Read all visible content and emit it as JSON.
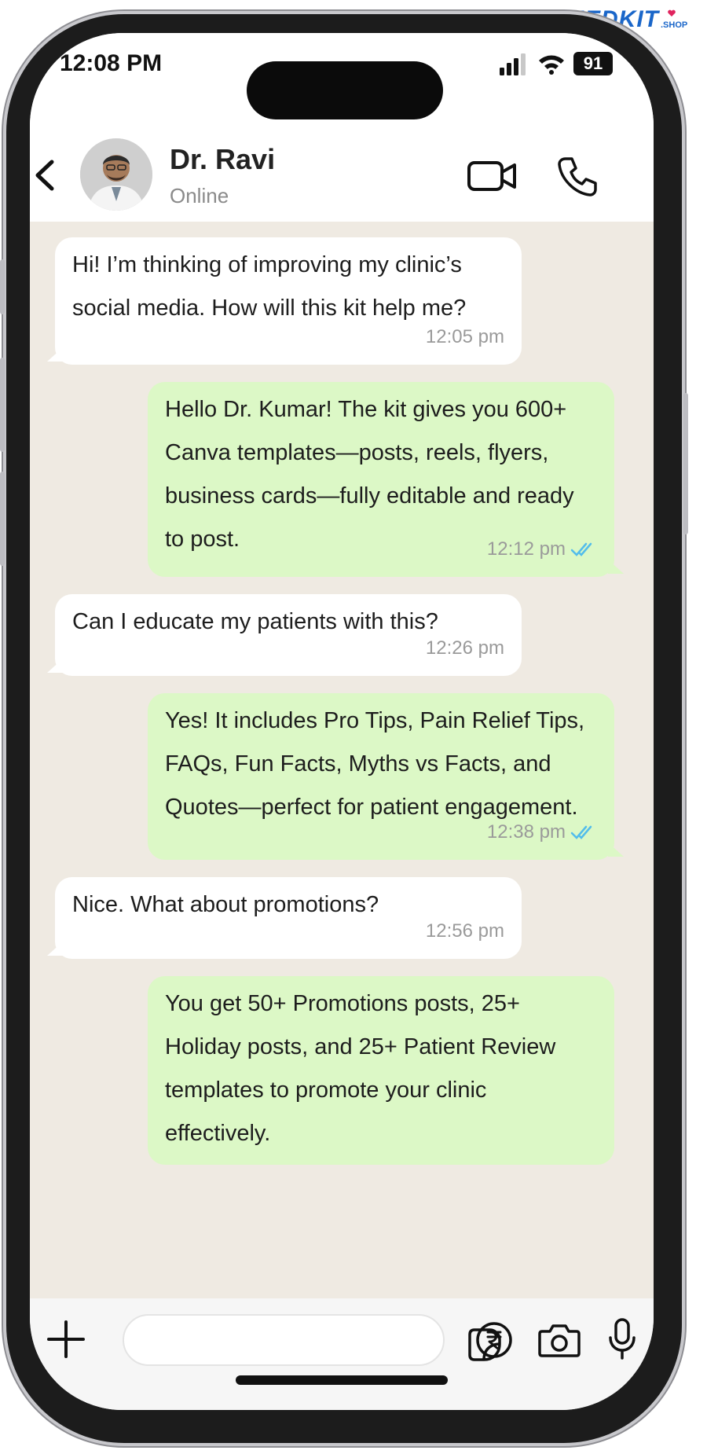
{
  "brand": {
    "name": "MEDKIT",
    "suffix": ".SHOP"
  },
  "status_bar": {
    "time": "12:08 PM",
    "battery": "91"
  },
  "header": {
    "contact_name": "Dr. Ravi",
    "contact_status": "Online"
  },
  "messages": [
    {
      "direction": "incoming",
      "text": "Hi! I’m thinking of improving my clinic’s social media. How will this kit help me?",
      "time": "12:05 pm"
    },
    {
      "direction": "outgoing",
      "text": "Hello Dr. Kumar! The kit gives you 600+ Canva templates—posts, reels, flyers, business cards—fully editable and ready to post.",
      "time": "12:12 pm",
      "read": true
    },
    {
      "direction": "incoming",
      "text": "Can I educate my patients with this?",
      "time": "12:26 pm"
    },
    {
      "direction": "outgoing",
      "text": "Yes! It includes Pro Tips, Pain Relief Tips, FAQs, Fun Facts, Myths vs Facts, and Quotes—perfect for patient engagement.",
      "time": "12:38 pm",
      "read": true
    },
    {
      "direction": "incoming",
      "text": "Nice. What about promotions?",
      "time": "12:56 pm"
    },
    {
      "direction": "outgoing",
      "text": "You get 50+ Promotions posts, 25+ Holiday posts, and 25+ Patient Review templates to promote your clinic effectively.",
      "time": ""
    }
  ],
  "input": {
    "value": "",
    "placeholder": ""
  },
  "colors": {
    "chat_background": "#efeae2",
    "incoming_bubble": "#ffffff",
    "outgoing_bubble": "#dcf8c6",
    "read_ticks": "#53bdeb",
    "brand_blue": "#1a66c9"
  }
}
